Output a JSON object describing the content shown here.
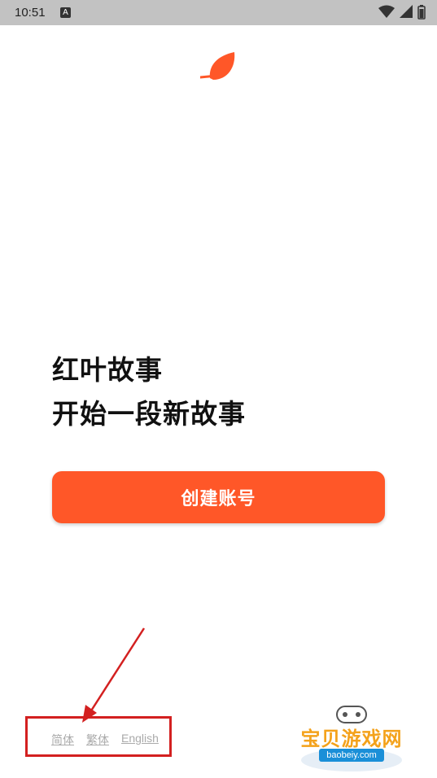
{
  "status_bar": {
    "time": "10:51",
    "notification_badge": "A",
    "icons": [
      "wifi-icon",
      "signal-icon",
      "battery-icon"
    ]
  },
  "brand": {
    "logo_icon": "leaf-icon",
    "accent_color": "#ff5728"
  },
  "headline": {
    "line1": "红叶故事",
    "line2": "开始一段新故事"
  },
  "primary_action": {
    "label": "创建账号"
  },
  "languages": [
    {
      "label": "简体"
    },
    {
      "label": "繁体"
    },
    {
      "label": "English"
    }
  ],
  "watermark": {
    "text": "宝贝游戏网",
    "url": "baobeiy.com"
  }
}
